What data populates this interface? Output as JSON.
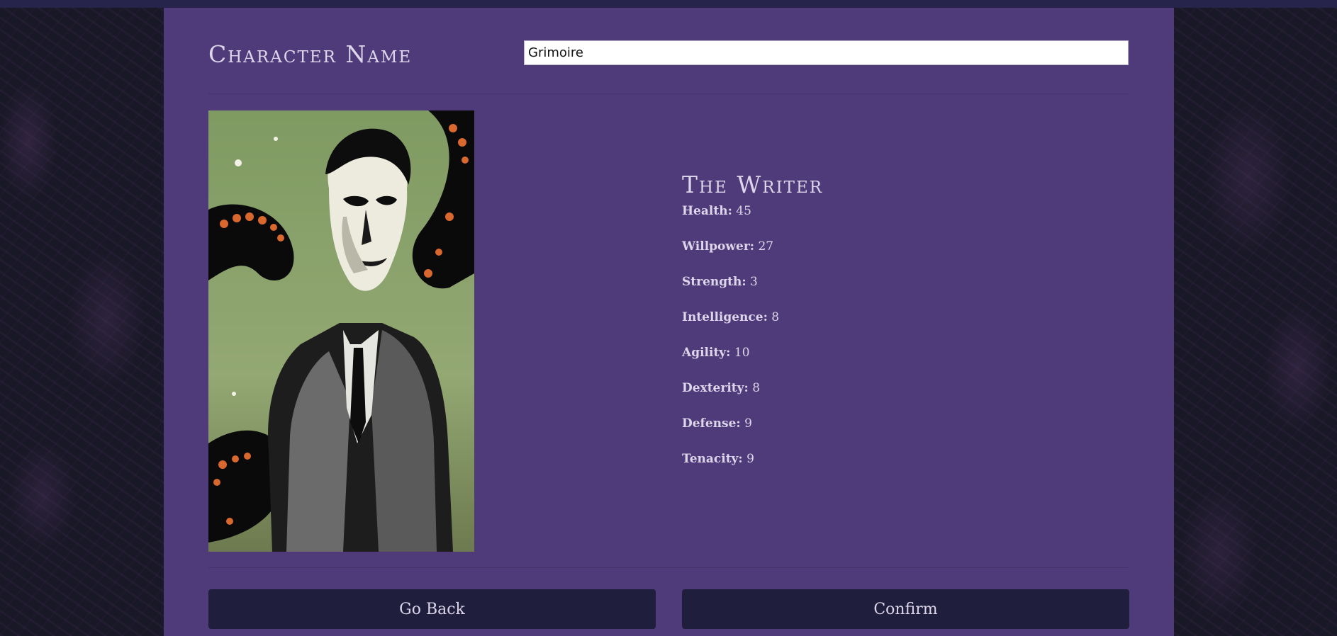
{
  "header": {
    "title": "Character Name",
    "name_value": "Grimoire"
  },
  "character": {
    "class_name": "The Writer",
    "portrait_icon": "writer-portrait",
    "stats": [
      {
        "label": "Health:",
        "value": "45"
      },
      {
        "label": "Willpower:",
        "value": "27"
      },
      {
        "label": "Strength:",
        "value": "3"
      },
      {
        "label": "Intelligence:",
        "value": "8"
      },
      {
        "label": "Agility:",
        "value": "10"
      },
      {
        "label": "Dexterity:",
        "value": "8"
      },
      {
        "label": "Defense:",
        "value": "9"
      },
      {
        "label": "Tenacity:",
        "value": "9"
      }
    ]
  },
  "actions": {
    "back_label": "Go Back",
    "confirm_label": "Confirm"
  },
  "colors": {
    "panel": "#4f3b7a",
    "background": "#191826",
    "button": "#1f1e3c",
    "text": "#ddd6ea"
  }
}
